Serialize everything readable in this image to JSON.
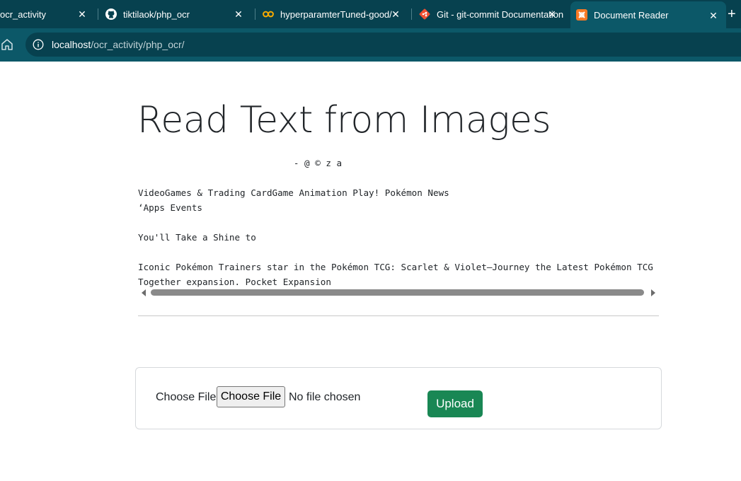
{
  "browser": {
    "tabs": [
      {
        "title": "ocr_activity",
        "icon": "page-icon"
      },
      {
        "title": "tiktilaok/php_ocr",
        "icon": "github-icon"
      },
      {
        "title": "hyperparamterTuned-good/",
        "icon": "colab-icon"
      },
      {
        "title": "Git - git-commit Documentation",
        "icon": "git-icon"
      },
      {
        "title": "Document Reader",
        "icon": "xampp-icon",
        "active": true
      }
    ],
    "address": {
      "host": "localhost",
      "path": "/ocr_activity/php_ocr/"
    },
    "close_glyph": "✕",
    "new_tab_glyph": "+"
  },
  "page": {
    "title": "Read Text from Images",
    "ocr_output": "                             - @ © z a\n\nVideoGames & Trading CardGame Animation Play! Pokémon News\n‘Apps Events\n\nYou'll Take a Shine to\n\nIconic Pokémon Trainers star in the Pokémon TCG: Scarlet & Violet—Journey the Latest Pokémon TCG\nTogether expansion. Pocket Expansion"
  },
  "upload_form": {
    "label": "Choose File",
    "file_button": "Choose File",
    "file_status": "No file chosen",
    "submit": "Upload"
  },
  "colors": {
    "chrome_dark": "#07414f",
    "chrome_tab": "#0c5868",
    "upload_button": "#198754"
  }
}
